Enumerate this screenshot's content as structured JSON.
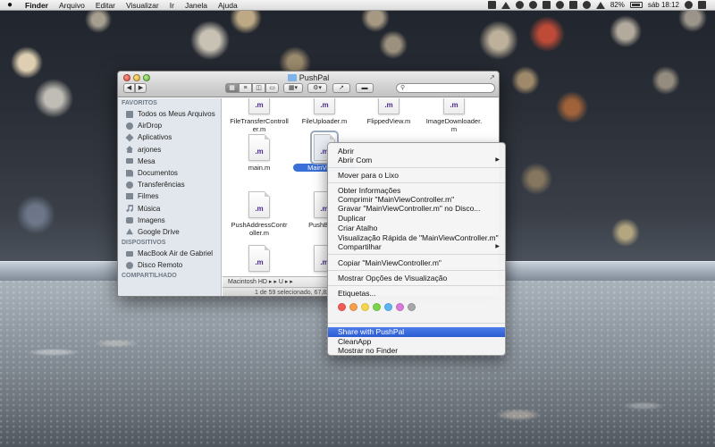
{
  "menubar": {
    "app_name": "Finder",
    "menus": [
      "Arquivo",
      "Editar",
      "Visualizar",
      "Ir",
      "Janela",
      "Ajuda"
    ],
    "battery": "82%",
    "clock": "sáb 18:12"
  },
  "window": {
    "title": "PushPal",
    "search_placeholder": ""
  },
  "sidebar": {
    "favorites_header": "FAVORITOS",
    "favorites": [
      {
        "label": "Todos os Meus Arquivos",
        "icon": "all-files-icon"
      },
      {
        "label": "AirDrop",
        "icon": "airdrop-icon"
      },
      {
        "label": "Aplicativos",
        "icon": "applications-icon"
      },
      {
        "label": "arjones",
        "icon": "home-icon"
      },
      {
        "label": "Mesa",
        "icon": "desktop-icon"
      },
      {
        "label": "Documentos",
        "icon": "documents-icon"
      },
      {
        "label": "Transferências",
        "icon": "downloads-icon"
      },
      {
        "label": "Filmes",
        "icon": "movies-icon"
      },
      {
        "label": "Música",
        "icon": "music-icon"
      },
      {
        "label": "Imagens",
        "icon": "pictures-icon"
      },
      {
        "label": "Google Drive",
        "icon": "google-drive-icon"
      }
    ],
    "devices_header": "DISPOSITIVOS",
    "devices": [
      {
        "label": "MacBook Air de Gabriel",
        "icon": "laptop-icon"
      },
      {
        "label": "Disco Remoto",
        "icon": "remote-disc-icon"
      }
    ],
    "shared_header": "COMPARTILHADO"
  },
  "files": [
    {
      "label": "FileTransferController.m",
      "ext": ".m"
    },
    {
      "label": "FileUploader.m",
      "ext": ".m"
    },
    {
      "label": "FlippedView.m",
      "ext": ".m"
    },
    {
      "label": "ImageDownloader.m",
      "ext": ".m"
    },
    {
      "label": "main.m",
      "ext": ".m"
    },
    {
      "label": "MainViewC",
      "ext": ".m"
    },
    {
      "label": "PushAddressController.m",
      "ext": ".m"
    },
    {
      "label": "PushBullet",
      "ext": ".m"
    },
    {
      "label": "",
      "ext": ".m"
    },
    {
      "label": "",
      "ext": ".m"
    }
  ],
  "path_bar": "Macintosh HD ▸ ▸ U ▸ ▸",
  "status_bar": "1 de 59 selecionado, 67,82 G",
  "context_menu": {
    "open": "Abrir",
    "open_with": "Abrir Com",
    "move_to_trash": "Mover para o Lixo",
    "get_info": "Obter Informações",
    "compress": "Comprimir \"MainViewController.m\"",
    "burn": "Gravar \"MainViewController.m\" no Disco...",
    "duplicate": "Duplicar",
    "make_alias": "Criar Atalho",
    "quick_look": "Visualização Rápida de \"MainViewController.m\"",
    "share": "Compartilhar",
    "copy": "Copiar \"MainViewController.m\"",
    "view_options": "Mostrar Opções de Visualização",
    "tags": "Etiquetas...",
    "tag_colors": [
      "#f05b55",
      "#f6a04d",
      "#f7d64a",
      "#7bd54a",
      "#5cb4f2",
      "#d77ad8",
      "#a8a8a8"
    ],
    "share_pushpal": "Share with PushPal",
    "cleanapp": "CleanApp",
    "show_in_finder": "Mostrar no Finder"
  }
}
